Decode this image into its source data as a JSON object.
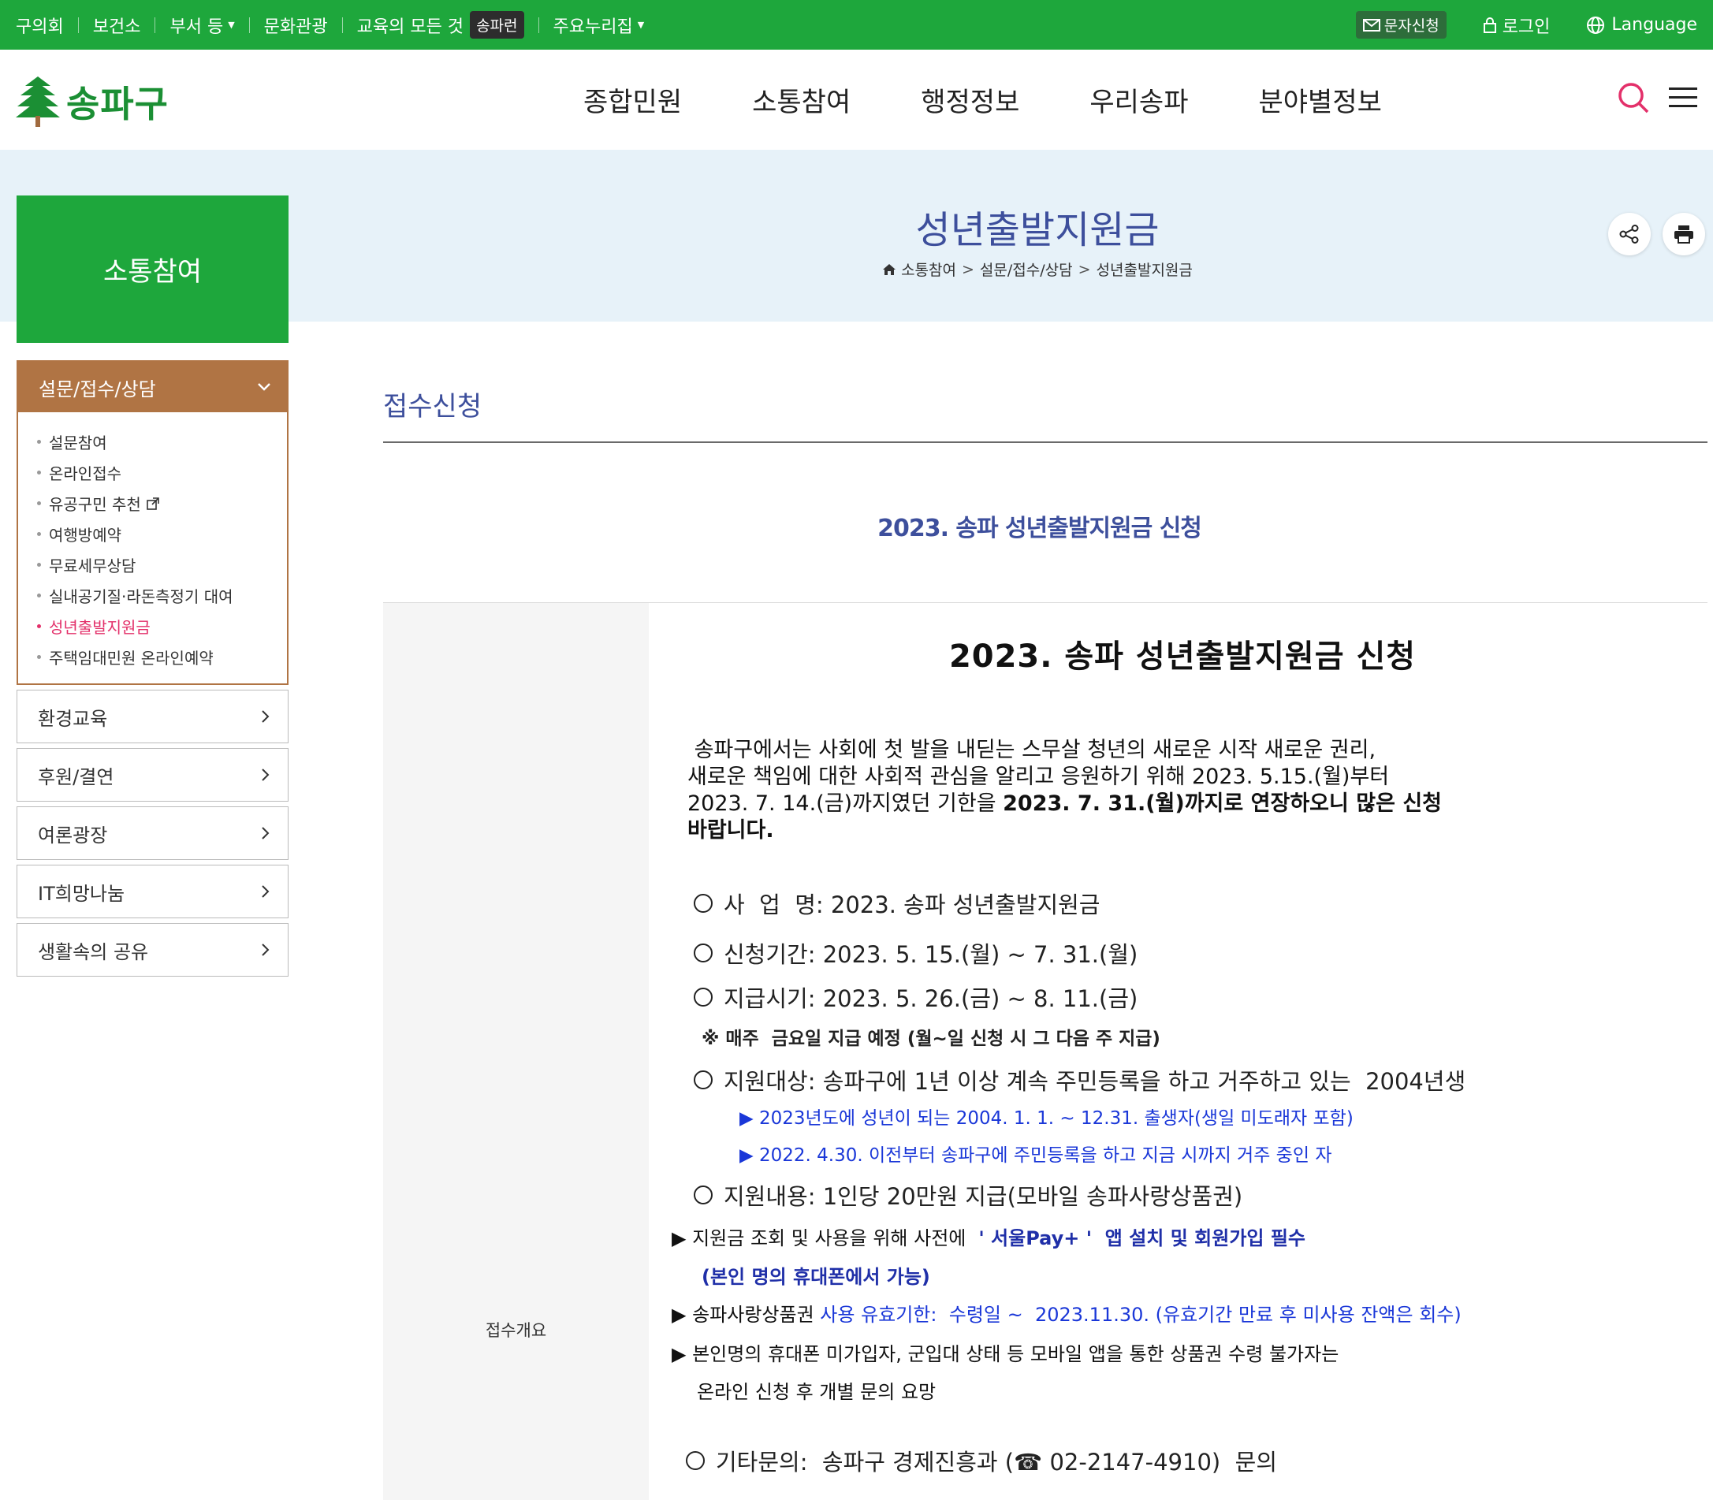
{
  "topbar": {
    "items": [
      "구의회",
      "보건소",
      "부서 등",
      "문화관광",
      "교육의 모든 것",
      "주요누리집"
    ],
    "edu_badge": "송파런",
    "sms": "문자신청",
    "login": "로그인",
    "language": "Language"
  },
  "header": {
    "logo": "송파구",
    "menu": [
      "종합민원",
      "소통참여",
      "행정정보",
      "우리송파",
      "분야별정보"
    ]
  },
  "sidebar": {
    "title": "소통참여",
    "open_group": "설문/접수/상담",
    "sub_items": [
      "설문참여",
      "온라인접수",
      "유공구민 추천",
      "여행방예약",
      "무료세무상담",
      "실내공기질·라돈측정기 대여",
      "성년출발지원금",
      "주택임대민원 온라인예약"
    ],
    "groups": [
      "환경교육",
      "후원/결연",
      "여론광장",
      "IT희망나눔",
      "생활속의 공유"
    ]
  },
  "page": {
    "title": "성년출발지원금",
    "breadcrumb": [
      "소통참여",
      "설문/접수/상담",
      "성년출발지원금"
    ],
    "section": "접수신청",
    "form_title": "2023. 송파 성년출발지원금 신청",
    "row_label": "접수개요"
  },
  "content": {
    "doc_title": "2023. 송파 성년출발지원금 신청",
    "intro_1": " 송파구에서는 사회에 첫 발을 내딛는 스무살 청년의 새로운 시작 새로운 권리,",
    "intro_2": "새로운 책임에 대한 사회적 관심을 알리고 응원하기 위해 2023. 5.15.(월)부터",
    "intro_3a": "2023. 7. 14.(금)까지였던 기한을 ",
    "intro_3b": "2023. 7. 31.(월)까지로 연장하오니 많은 신청",
    "intro_4": "바랍니다.",
    "line_project": "사  업  명: 2023. 송파 성년출발지원금",
    "line_period": "신청기간: 2023. 5. 15.(월) ~ 7. 31.(월)",
    "line_payment": "지급시기: 2023. 5. 26.(금) ~ 8. 11.(금)",
    "note_weekly": "※ 매주  금요일 지급 예정 (월~일 신청 시 그 다음 주 지급)",
    "line_target": "지원대상: 송파구에 1년 이상 계속 주민등록을 하고 거주하고 있는  2004년생",
    "target_1": "▶ 2023년도에 성년이 되는 2004. 1. 1. ~ 12.31. 출생자(생일 미도래자 포함)",
    "target_2": "▶ 2022. 4.30. 이전부터 송파구에 주민등록을 하고 지금 시까지 거주 중인 자",
    "line_support": "지원내용: 1인당 20만원 지급(모바일 송파사랑상품권)",
    "arrow_1": "▶ 지원금 조회 및 사용을 위해 사전에 ",
    "arrow_1_navy": " ' 서울Pay+ '  앱 설치 및 회원가입 필수",
    "arrow_1_sub": "(본인 명의 휴대폰에서 가능)",
    "arrow_2": "▶ 송파사랑상품권 ",
    "arrow_2_blue": "사용 유효기한:  수령일 ~  2023.11.30. (유효기간 만료 후 미사용 잔액은 회수)",
    "arrow_3": "▶ 본인명의 휴대폰 미가입자, 군입대 상태 등 모바일 앱을 통한 상품권 수령 불가자는",
    "arrow_3_sub": "온라인 신청 후 개별 문의 요망",
    "line_contact": "기타문의:  송파구 경제진흥과 (☎ 02-2147-4910)  문의"
  },
  "colors": {
    "brand_green": "#1ea73c",
    "lnb_brown": "#b07444",
    "title_blue": "#3d4f9c",
    "link_blue": "#1a37d8",
    "active_pink": "#e3306a"
  }
}
